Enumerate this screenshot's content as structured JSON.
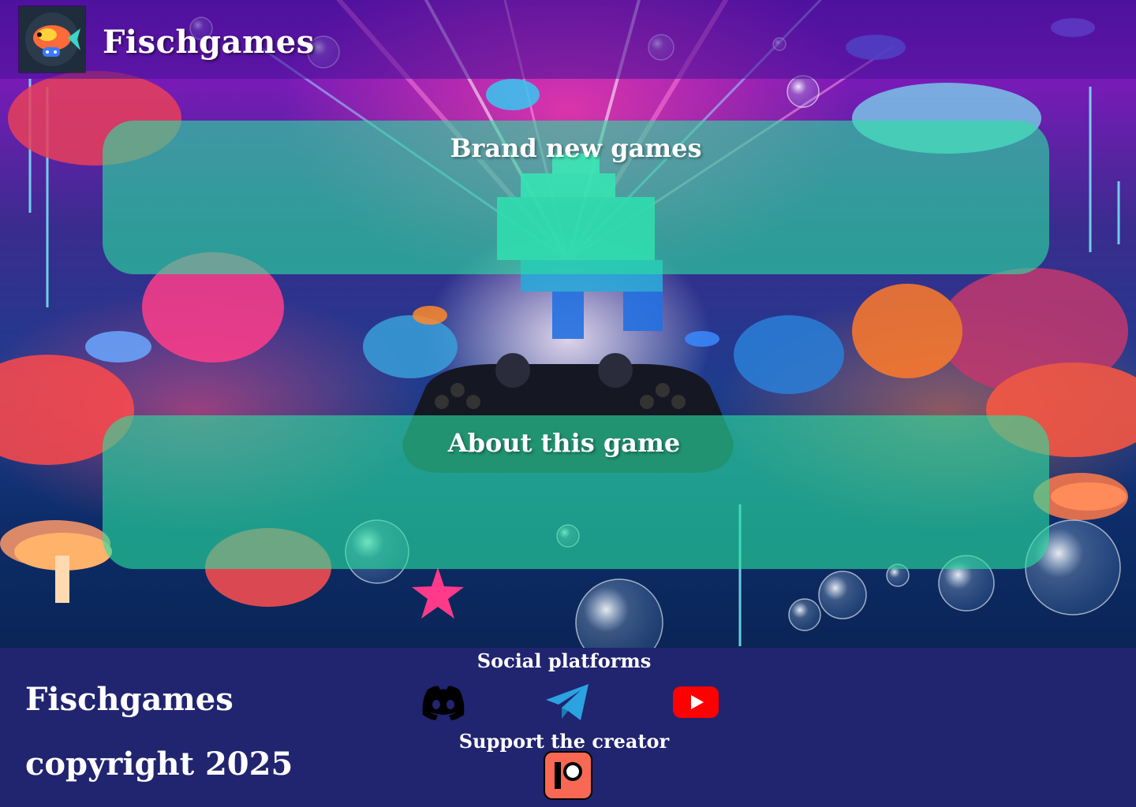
{
  "header": {
    "logo_icon": "fish-logo-icon",
    "title": "Fischgames"
  },
  "panels": [
    {
      "title": "Brand new games"
    },
    {
      "title": "About this game"
    }
  ],
  "footer": {
    "brand": "Fischgames",
    "copyright": "copyright 2025",
    "social_heading": "Social platforms",
    "social_links": [
      {
        "name": "Discord",
        "icon": "discord-icon",
        "color": "#000000"
      },
      {
        "name": "Telegram",
        "icon": "telegram-icon",
        "color": "#2aa3e0"
      },
      {
        "name": "YouTube",
        "icon": "youtube-icon",
        "color": "#ff0000"
      }
    ],
    "support_heading": "Support the creator",
    "support_link": {
      "name": "Patreon",
      "icon": "patreon-icon",
      "color": "#f96854"
    }
  },
  "colors": {
    "header_bg": "#46129699",
    "panel_bg": "#28e1a0",
    "footer_bg": "#21246f",
    "text": "#ffffff"
  }
}
